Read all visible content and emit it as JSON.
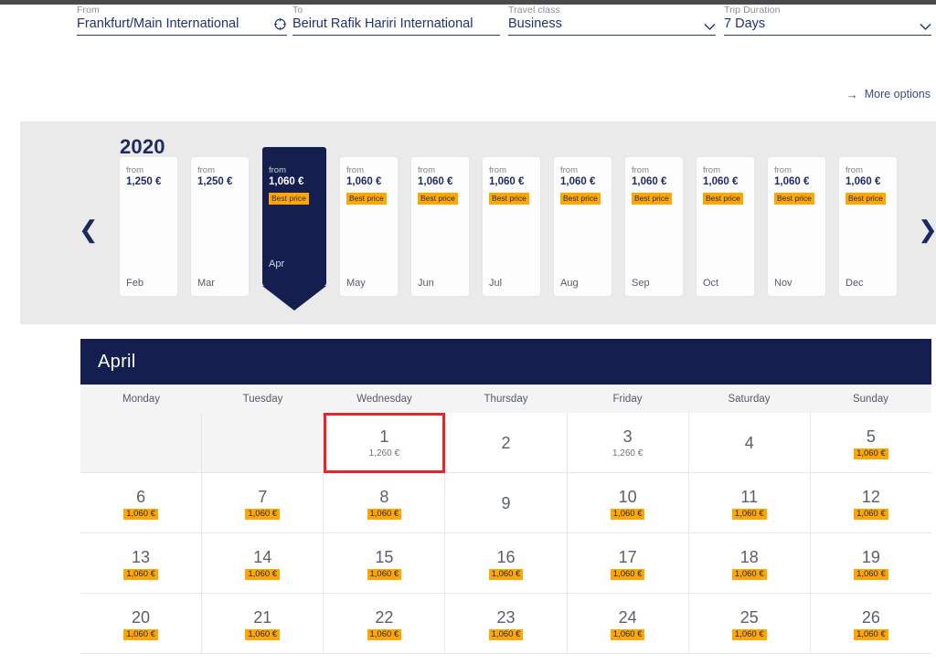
{
  "search": {
    "from": {
      "label": "From",
      "value": "Frankfurt/Main International",
      "icon": "swap-locations-icon"
    },
    "to": {
      "label": "To",
      "value": "Beirut Rafik Hariri International"
    },
    "travel_class": {
      "label": "Travel class",
      "value": "Business",
      "icon": "chevron-down-icon"
    },
    "trip_duration": {
      "label": "Trip Duration",
      "value": "7 Days",
      "icon": "chevron-down-icon"
    },
    "more_options": {
      "label": "More options",
      "icon": "arrow-right-icon"
    }
  },
  "carousel": {
    "year": "2020",
    "prev_icon": "chevron-left-icon",
    "next_icon": "chevron-right-icon",
    "from_label": "from",
    "best_price_label": "Best price",
    "months": [
      {
        "name": "Feb",
        "price": "1,250 €",
        "best": false,
        "selected": false
      },
      {
        "name": "Mar",
        "price": "1,250 €",
        "best": false,
        "selected": false
      },
      {
        "name": "Apr",
        "price": "1,060 €",
        "best": true,
        "selected": true
      },
      {
        "name": "May",
        "price": "1,060 €",
        "best": true,
        "selected": false
      },
      {
        "name": "Jun",
        "price": "1,060 €",
        "best": true,
        "selected": false
      },
      {
        "name": "Jul",
        "price": "1,060 €",
        "best": true,
        "selected": false
      },
      {
        "name": "Aug",
        "price": "1,060 €",
        "best": true,
        "selected": false
      },
      {
        "name": "Sep",
        "price": "1,060 €",
        "best": true,
        "selected": false
      },
      {
        "name": "Oct",
        "price": "1,060 €",
        "best": true,
        "selected": false
      },
      {
        "name": "Nov",
        "price": "1,060 €",
        "best": true,
        "selected": false
      },
      {
        "name": "Dec",
        "price": "1,060 €",
        "best": true,
        "selected": false
      }
    ]
  },
  "calendar": {
    "month_title": "April",
    "weekdays": [
      "Monday",
      "Tuesday",
      "Wednesday",
      "Thursday",
      "Friday",
      "Saturday",
      "Sunday"
    ],
    "weeks": [
      [
        {
          "day": "",
          "price": "",
          "badge": false,
          "empty": true,
          "selected": false
        },
        {
          "day": "",
          "price": "",
          "badge": false,
          "empty": true,
          "selected": false
        },
        {
          "day": "1",
          "price": "1,260 €",
          "badge": false,
          "empty": false,
          "selected": true
        },
        {
          "day": "2",
          "price": "",
          "badge": false,
          "empty": false,
          "selected": false
        },
        {
          "day": "3",
          "price": "1,260 €",
          "badge": false,
          "empty": false,
          "selected": false
        },
        {
          "day": "4",
          "price": "",
          "badge": false,
          "empty": false,
          "selected": false
        },
        {
          "day": "5",
          "price": "1,060 €",
          "badge": true,
          "empty": false,
          "selected": false
        }
      ],
      [
        {
          "day": "6",
          "price": "1,060 €",
          "badge": true,
          "empty": false,
          "selected": false
        },
        {
          "day": "7",
          "price": "1,060 €",
          "badge": true,
          "empty": false,
          "selected": false
        },
        {
          "day": "8",
          "price": "1,060 €",
          "badge": true,
          "empty": false,
          "selected": false
        },
        {
          "day": "9",
          "price": "",
          "badge": false,
          "empty": false,
          "selected": false
        },
        {
          "day": "10",
          "price": "1,060 €",
          "badge": true,
          "empty": false,
          "selected": false
        },
        {
          "day": "11",
          "price": "1,060 €",
          "badge": true,
          "empty": false,
          "selected": false
        },
        {
          "day": "12",
          "price": "1,060 €",
          "badge": true,
          "empty": false,
          "selected": false
        }
      ],
      [
        {
          "day": "13",
          "price": "1,060 €",
          "badge": true,
          "empty": false,
          "selected": false
        },
        {
          "day": "14",
          "price": "1,060 €",
          "badge": true,
          "empty": false,
          "selected": false
        },
        {
          "day": "15",
          "price": "1,060 €",
          "badge": true,
          "empty": false,
          "selected": false
        },
        {
          "day": "16",
          "price": "1,060 €",
          "badge": true,
          "empty": false,
          "selected": false
        },
        {
          "day": "17",
          "price": "1,060 €",
          "badge": true,
          "empty": false,
          "selected": false
        },
        {
          "day": "18",
          "price": "1,060 €",
          "badge": true,
          "empty": false,
          "selected": false
        },
        {
          "day": "19",
          "price": "1,060 €",
          "badge": true,
          "empty": false,
          "selected": false
        }
      ],
      [
        {
          "day": "20",
          "price": "1,060 €",
          "badge": true,
          "empty": false,
          "selected": false
        },
        {
          "day": "21",
          "price": "1,060 €",
          "badge": true,
          "empty": false,
          "selected": false
        },
        {
          "day": "22",
          "price": "1,060 €",
          "badge": true,
          "empty": false,
          "selected": false
        },
        {
          "day": "23",
          "price": "1,060 €",
          "badge": true,
          "empty": false,
          "selected": false
        },
        {
          "day": "24",
          "price": "1,060 €",
          "badge": true,
          "empty": false,
          "selected": false
        },
        {
          "day": "25",
          "price": "1,060 €",
          "badge": true,
          "empty": false,
          "selected": false
        },
        {
          "day": "26",
          "price": "1,060 €",
          "badge": true,
          "empty": false,
          "selected": false
        }
      ]
    ]
  },
  "colors": {
    "navy": "#141f4f",
    "accent_amber": "#ffa700",
    "selection_red": "#e8232a",
    "panel_gray": "#eaeaea"
  }
}
